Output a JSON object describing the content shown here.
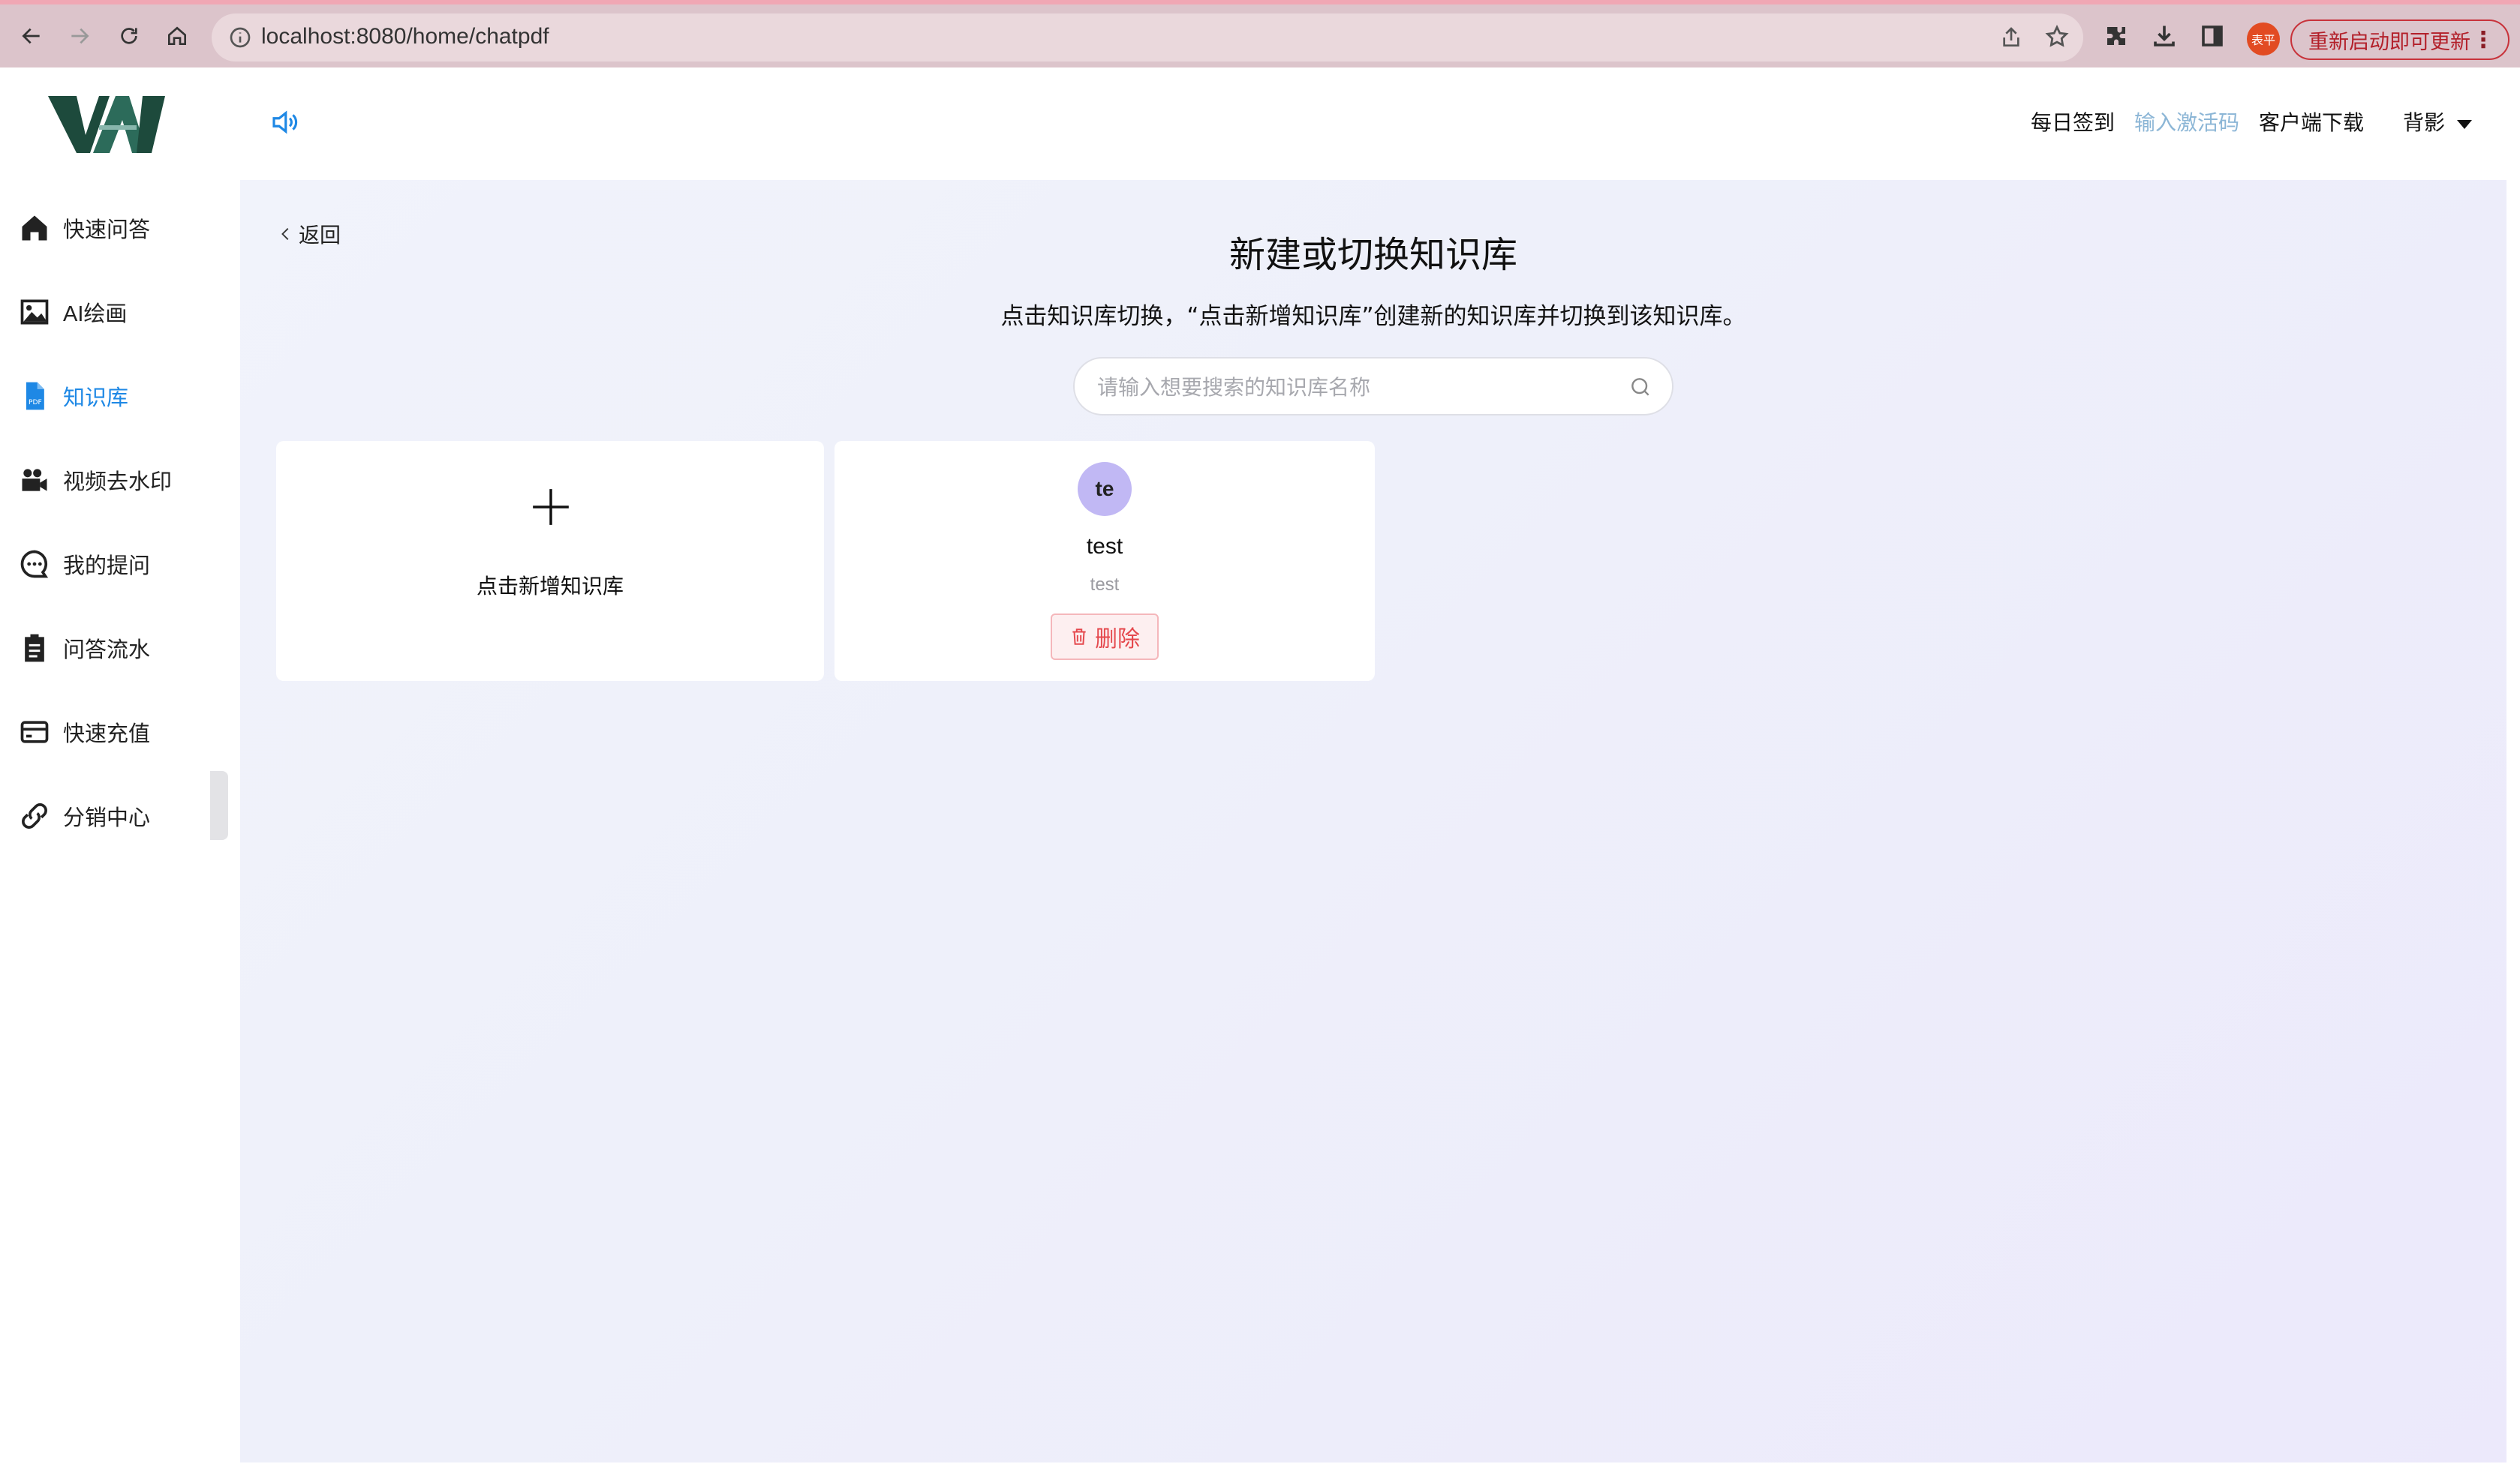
{
  "browser": {
    "url": "localhost:8080/home/chatpdf",
    "profile_label": "表平",
    "update_label": "重新启动即可更新"
  },
  "sidebar": {
    "items": [
      {
        "label": "快速问答",
        "icon": "home-icon"
      },
      {
        "label": "AI绘画",
        "icon": "image-icon"
      },
      {
        "label": "知识库",
        "icon": "pdf-file-icon",
        "active": true
      },
      {
        "label": "视频去水印",
        "icon": "video-camera-icon"
      },
      {
        "label": "我的提问",
        "icon": "chat-bubble-icon"
      },
      {
        "label": "问答流水",
        "icon": "clipboard-icon"
      },
      {
        "label": "快速充值",
        "icon": "credit-card-icon"
      },
      {
        "label": "分销中心",
        "icon": "share-link-icon"
      }
    ]
  },
  "header": {
    "checkin": "每日签到",
    "activation": "输入激活码",
    "download": "客户端下载",
    "user": "背影"
  },
  "main": {
    "back_label": "返回",
    "title": "新建或切换知识库",
    "subtitle": "点击知识库切换，“点击新增知识库”创建新的知识库并切换到该知识库。",
    "search_placeholder": "请输入想要搜索的知识库名称",
    "add_label": "点击新增知识库",
    "knowledge_bases": [
      {
        "avatar": "te",
        "name": "test",
        "desc": "test",
        "delete_label": "删除"
      }
    ]
  },
  "colors": {
    "accent": "#1e88e5",
    "danger": "#e5484d",
    "avatar_bg": "#c1b8f4",
    "activation_link": "#8cb6d6"
  }
}
